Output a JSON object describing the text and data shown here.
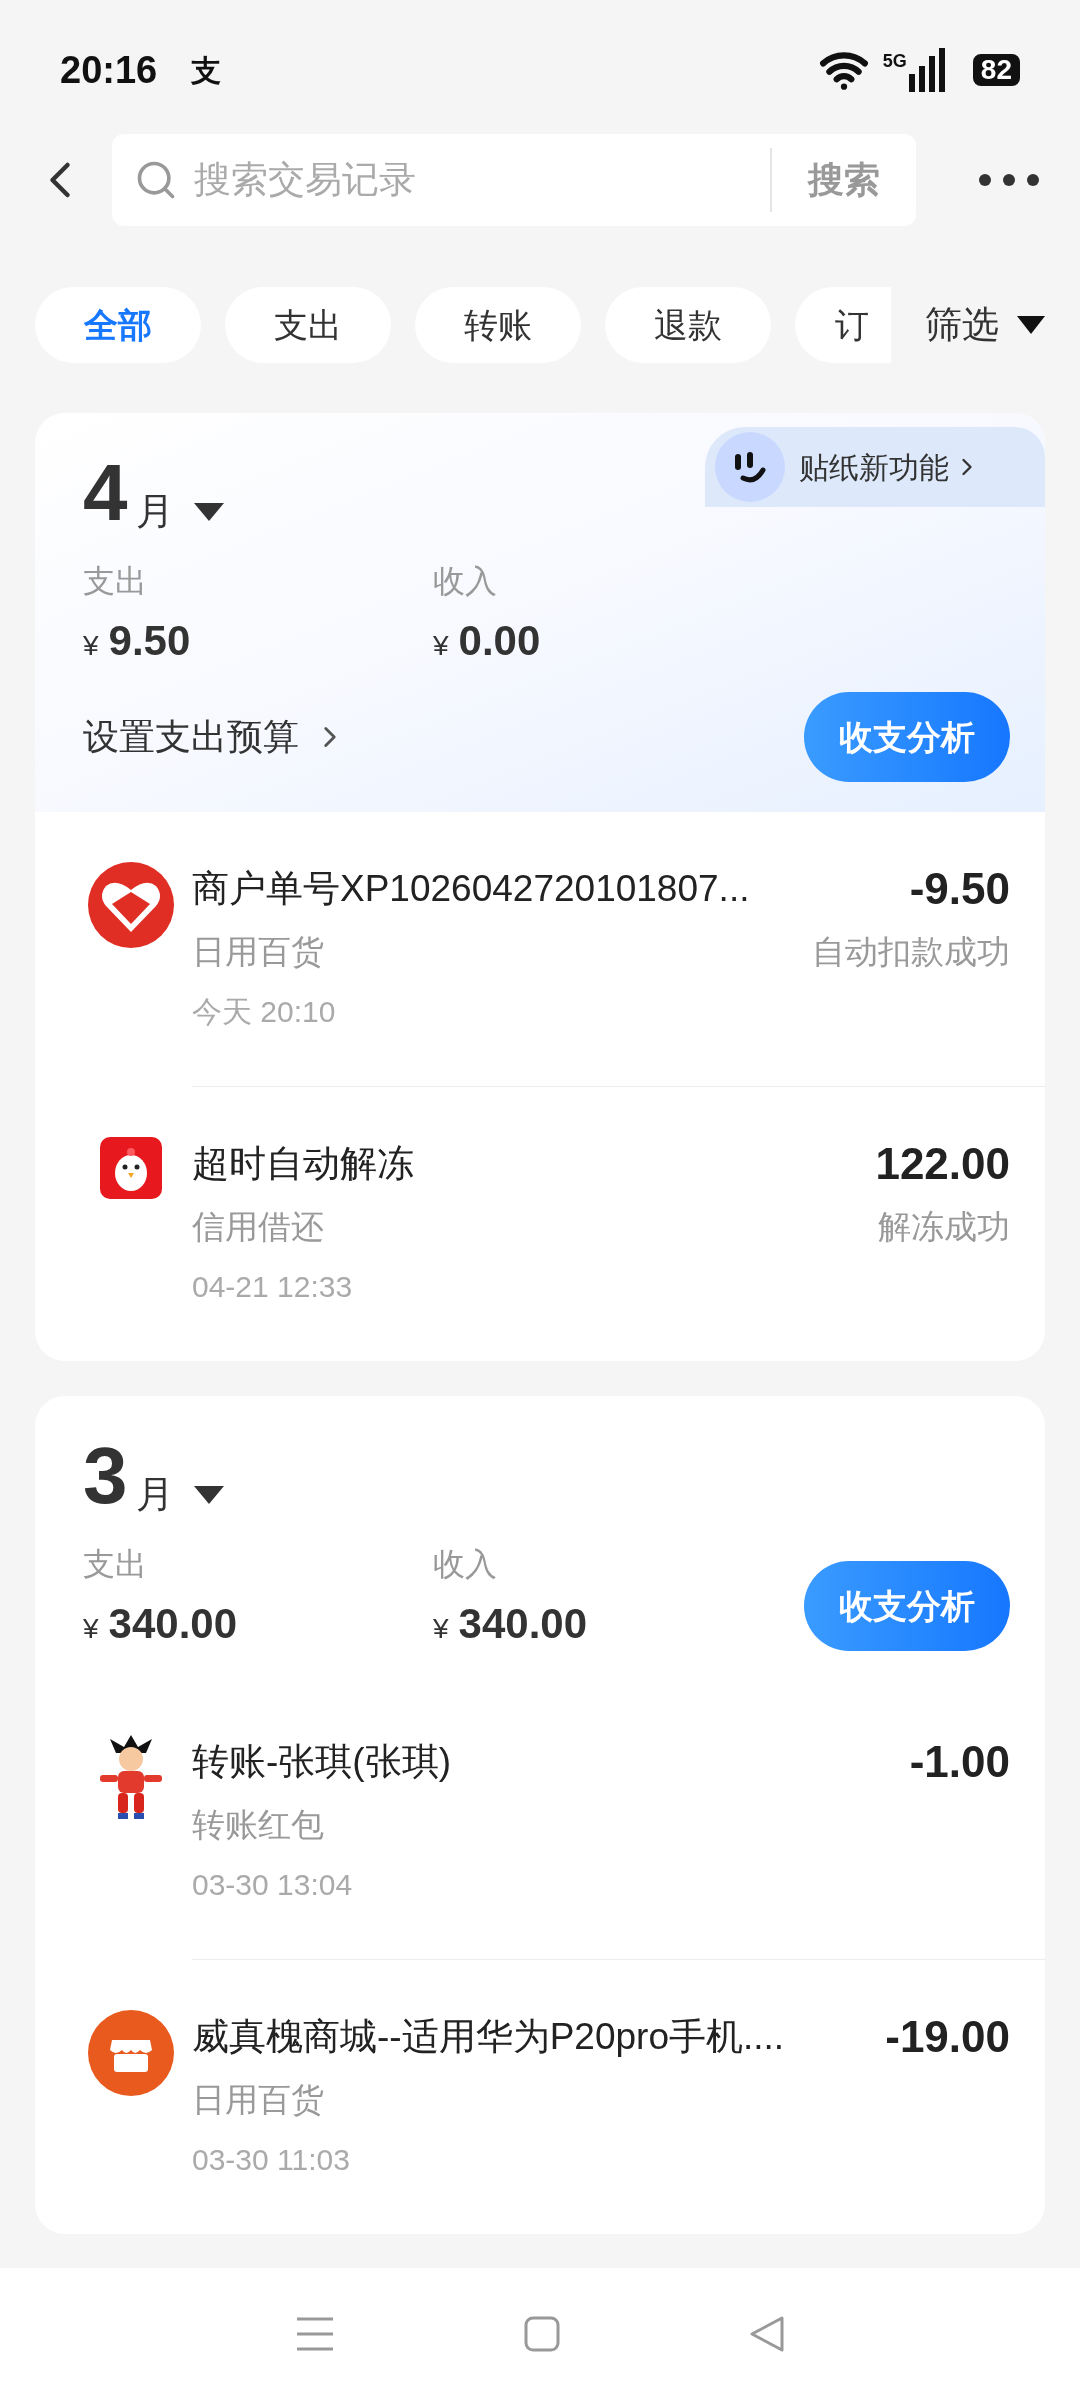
{
  "status_bar": {
    "time": "20:16",
    "app_glyph": "支",
    "network": "5G",
    "battery": "82"
  },
  "search": {
    "placeholder": "搜索交易记录",
    "button": "搜索"
  },
  "filters": [
    {
      "label": "全部",
      "selected": true
    },
    {
      "label": "支出",
      "selected": false
    },
    {
      "label": "转账",
      "selected": false
    },
    {
      "label": "退款",
      "selected": false
    },
    {
      "label": "订",
      "selected": false
    }
  ],
  "filter_button": "筛选",
  "months": [
    {
      "month": "4",
      "unit": "月",
      "currency": "¥",
      "expense_label": "支出",
      "expense": "9.50",
      "income_label": "收入",
      "income": "0.00",
      "budget_link": "设置支出预算",
      "analysis_button": "收支分析",
      "sticker_promo": "贴纸新功能",
      "transactions": [
        {
          "kind": "heart",
          "title": "商户单号XP1026042720101807...",
          "category": "日用百货",
          "time": "今天 20:10",
          "amount": "-9.50",
          "status": "自动扣款成功"
        },
        {
          "kind": "chick",
          "title": "超时自动解冻",
          "category": "信用借还",
          "time": "04-21 12:33",
          "amount": "122.00",
          "status": "解冻成功"
        }
      ]
    },
    {
      "month": "3",
      "unit": "月",
      "currency": "¥",
      "expense_label": "支出",
      "expense": "340.00",
      "income_label": "收入",
      "income": "340.00",
      "analysis_button": "收支分析",
      "transactions": [
        {
          "kind": "figure",
          "title": "转账-张琪(张琪)",
          "category": "转账红包",
          "time": "03-30 13:04",
          "amount": "-1.00"
        },
        {
          "kind": "shop",
          "title": "威真槐商城--适用华为P20pro手机....",
          "category": "日用百货",
          "time": "03-30 11:03",
          "amount": "-19.00"
        }
      ]
    }
  ]
}
